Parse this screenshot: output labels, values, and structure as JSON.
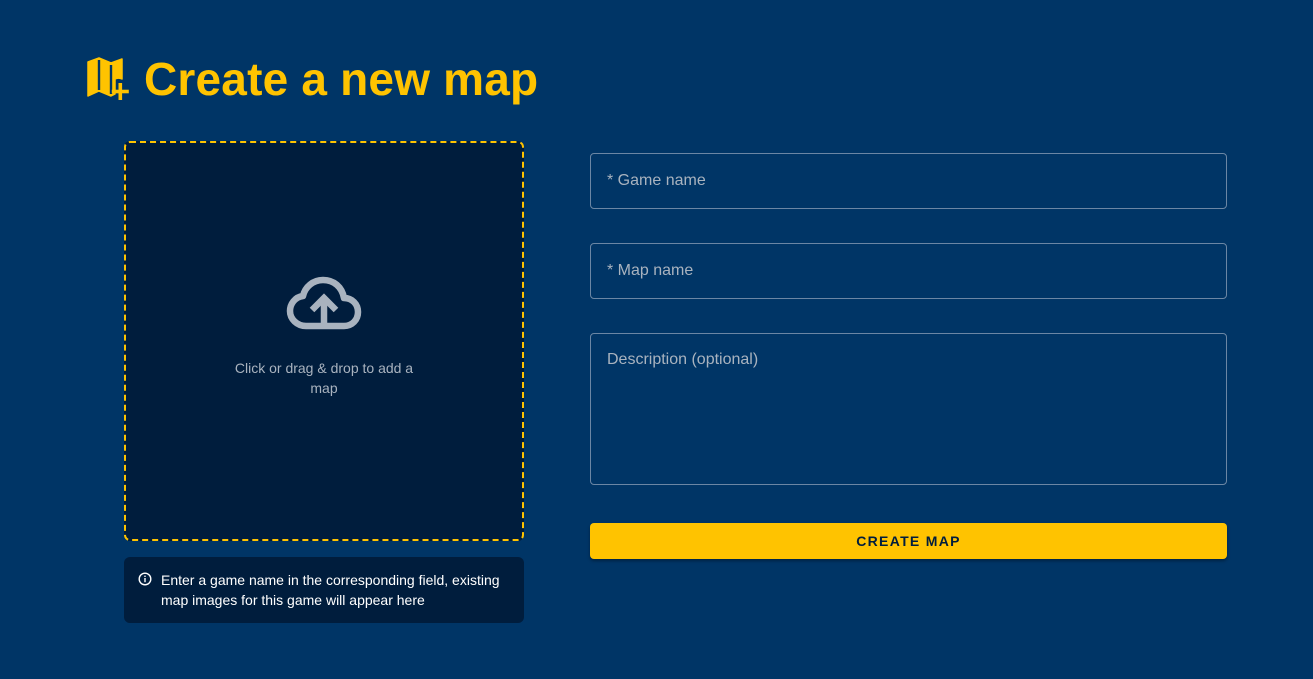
{
  "header": {
    "title": "Create a new map",
    "icon": "map-plus-icon"
  },
  "dropzone": {
    "icon": "cloud-upload-icon",
    "text": "Click or drag & drop to add a map"
  },
  "info": {
    "icon": "info-icon",
    "text": "Enter a game name in the corresponding field, existing map images for this game will appear here"
  },
  "form": {
    "game_name": {
      "value": "",
      "placeholder": "* Game name"
    },
    "map_name": {
      "value": "",
      "placeholder": "* Map name"
    },
    "description": {
      "value": "",
      "placeholder": "Description (optional)"
    },
    "submit_label": "CREATE MAP"
  },
  "colors": {
    "background": "#003566",
    "panel": "#001d3d",
    "accent": "#ffc300",
    "muted_text": "#a9b3bf",
    "field_border": "#6b86a4"
  }
}
